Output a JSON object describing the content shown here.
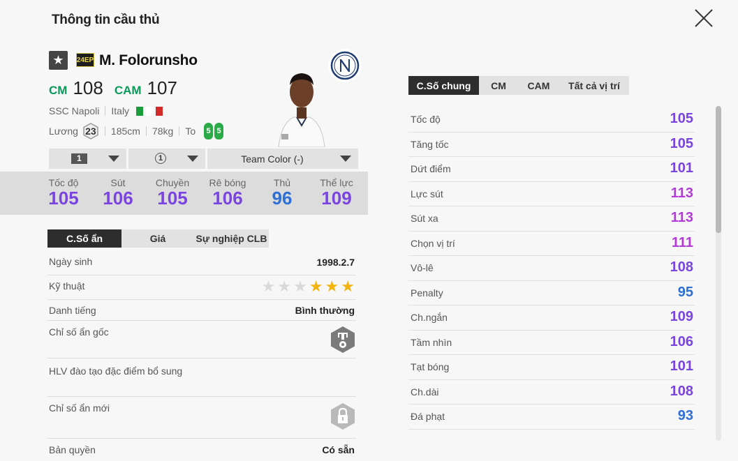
{
  "page": {
    "title": "Thông tin cầu thủ"
  },
  "player": {
    "favorite_icon": "star-icon",
    "season": "24EP",
    "name": "M. Folorunsho",
    "positions": [
      {
        "label": "CM",
        "value": "108"
      },
      {
        "label": "CAM",
        "value": "107"
      }
    ],
    "club": "SSC Napoli",
    "nation": "Italy",
    "salary_label": "Lương",
    "salary": "23",
    "height": "185cm",
    "weight": "78kg",
    "body_type": "To",
    "feet": [
      "5",
      "5"
    ]
  },
  "selectors": {
    "level": "1",
    "upgrade": "1",
    "team_color": "Team Color (-)"
  },
  "summary_stats": [
    {
      "label": "Tốc độ",
      "value": "105",
      "color": "purple"
    },
    {
      "label": "Sút",
      "value": "106",
      "color": "purple"
    },
    {
      "label": "Chuyền",
      "value": "105",
      "color": "purple"
    },
    {
      "label": "Rê bóng",
      "value": "106",
      "color": "purple"
    },
    {
      "label": "Thủ",
      "value": "96",
      "color": "blue"
    },
    {
      "label": "Thể lực",
      "value": "109",
      "color": "purple"
    }
  ],
  "left_tabs": [
    "C.Số ẩn",
    "Giá",
    "Sự nghiệp CLB"
  ],
  "details": {
    "birth_label": "Ngày sinh",
    "birth": "1998.2.7",
    "skill_label": "Kỹ thuật",
    "skill_stars": 3,
    "skill_max": 6,
    "reputation_label": "Danh tiếng",
    "reputation": "Bình thường",
    "hidden_label": "Chỉ số ẩn gốc",
    "coach_label": "HLV đào tạo đặc điểm bổ sung",
    "new_hidden_label": "Chỉ số ẩn mới",
    "license_label": "Bản quyền",
    "license": "Có sẵn"
  },
  "right_tabs": [
    "C.Số chung",
    "CM",
    "CAM",
    "Tất cả vị trí"
  ],
  "stats": [
    {
      "label": "Tốc độ",
      "value": "105",
      "color": "purple"
    },
    {
      "label": "Tăng tốc",
      "value": "105",
      "color": "purple"
    },
    {
      "label": "Dứt điểm",
      "value": "101",
      "color": "purple"
    },
    {
      "label": "Lực sút",
      "value": "113",
      "color": "pink"
    },
    {
      "label": "Sút xa",
      "value": "113",
      "color": "pink"
    },
    {
      "label": "Chọn vị trí",
      "value": "111",
      "color": "pink"
    },
    {
      "label": "Vô-lê",
      "value": "108",
      "color": "purple"
    },
    {
      "label": "Penalty",
      "value": "95",
      "color": "blue"
    },
    {
      "label": "Ch.ngắn",
      "value": "109",
      "color": "purple"
    },
    {
      "label": "Tầm nhìn",
      "value": "106",
      "color": "purple"
    },
    {
      "label": "Tạt bóng",
      "value": "101",
      "color": "purple"
    },
    {
      "label": "Ch.dài",
      "value": "108",
      "color": "purple"
    },
    {
      "label": "Đá phạt",
      "value": "93",
      "color": "blue"
    }
  ],
  "colors": {
    "purple": "#7a44e0",
    "pink": "#b33cd8",
    "blue": "#2e6fd6",
    "position_green": "#0a9a5a",
    "star_on": "#f3b410"
  }
}
